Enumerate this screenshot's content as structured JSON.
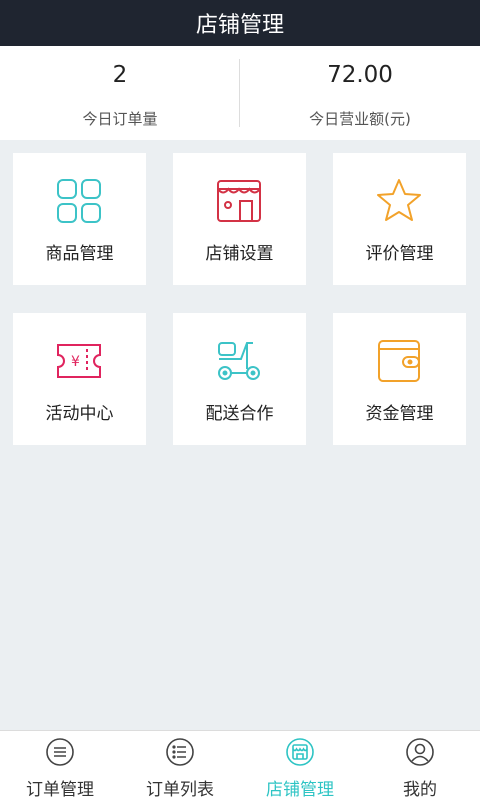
{
  "header": {
    "title": "店铺管理"
  },
  "stats": [
    {
      "value": "2",
      "label": "今日订单量"
    },
    {
      "value": "72.00",
      "label": "今日营业额(元)"
    }
  ],
  "tiles": [
    {
      "label": "商品管理",
      "icon": "grid-icon",
      "color": "#3cc3c7"
    },
    {
      "label": "店铺设置",
      "icon": "store-icon",
      "color": "#d33245"
    },
    {
      "label": "评价管理",
      "icon": "star-icon",
      "color": "#f2a22a"
    },
    {
      "label": "活动中心",
      "icon": "ticket-icon",
      "color": "#e0245e"
    },
    {
      "label": "配送合作",
      "icon": "scooter-icon",
      "color": "#3cc3c7"
    },
    {
      "label": "资金管理",
      "icon": "wallet-icon",
      "color": "#f2a22a"
    }
  ],
  "tabbar": [
    {
      "label": "订单管理",
      "icon": "order-manage-icon",
      "active": false
    },
    {
      "label": "订单列表",
      "icon": "order-list-icon",
      "active": false
    },
    {
      "label": "店铺管理",
      "icon": "store-manage-icon",
      "active": true
    },
    {
      "label": "我的",
      "icon": "profile-icon",
      "active": false
    }
  ],
  "colors": {
    "header": "#1f2530",
    "accent": "#2ec4c4",
    "background": "#ebeff2"
  }
}
